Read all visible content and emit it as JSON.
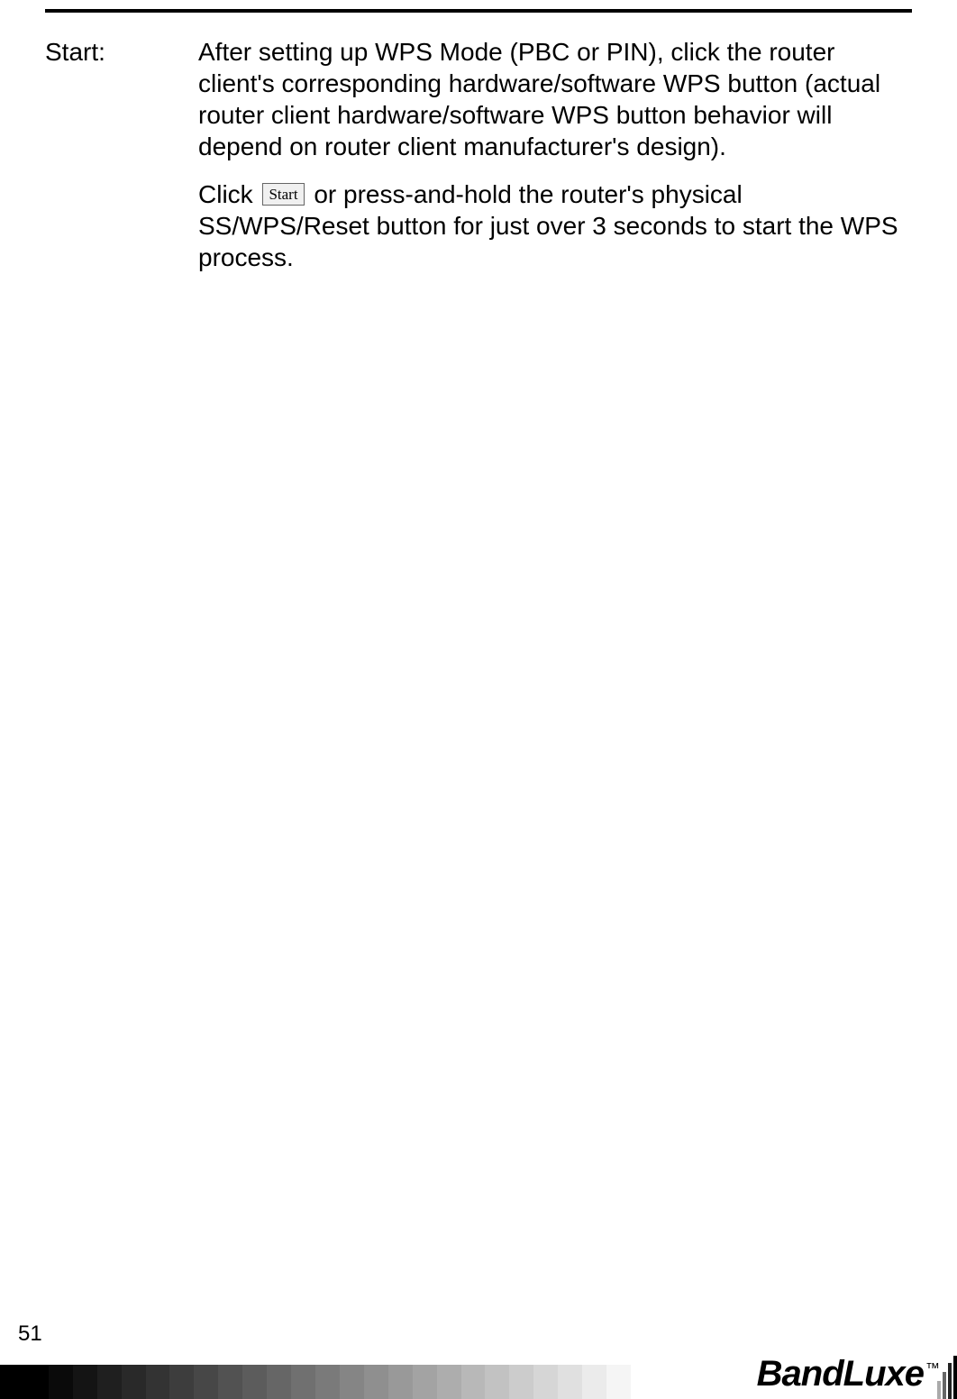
{
  "entry": {
    "label": "Start:",
    "paragraph1": "After setting up WPS Mode (PBC or PIN), click the router client's corresponding hardware/software WPS button (actual router client hardware/software WPS button behavior will depend on router client manufacturer's design).",
    "paragraph2_before": "Click ",
    "button_label": "Start",
    "paragraph2_after": " or press-and-hold the router's physical SS/WPS/Reset button for just over 3 seconds to start the WPS process."
  },
  "page_number": "51",
  "brand": {
    "name": "BandLuxe",
    "tm": "™"
  },
  "gradient_colors": [
    "#000000",
    "#000000",
    "#0a0a0a",
    "#141414",
    "#1f1f1f",
    "#292929",
    "#333333",
    "#3d3d3d",
    "#474747",
    "#525252",
    "#5c5c5c",
    "#666666",
    "#707070",
    "#7a7a7a",
    "#858585",
    "#8f8f8f",
    "#999999",
    "#a3a3a3",
    "#adadad",
    "#b8b8b8",
    "#c2c2c2",
    "#cccccc",
    "#d6d6d6",
    "#e0e0e0",
    "#ebebeb",
    "#f5f5f5"
  ]
}
